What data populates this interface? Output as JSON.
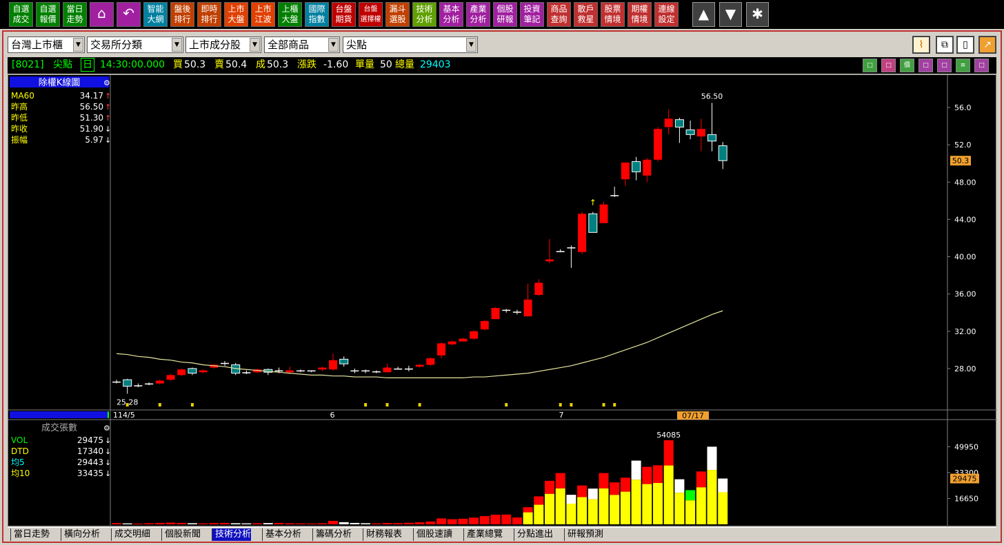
{
  "toolbar": {
    "buttons": [
      {
        "label": "自選\n成交",
        "color": "#008000"
      },
      {
        "label": "自選\n報價",
        "color": "#008000"
      },
      {
        "label": "當日\n走勢",
        "color": "#008000"
      },
      {
        "label": "",
        "icon": "home-icon",
        "color": "#a020a0"
      },
      {
        "label": "",
        "icon": "back-icon",
        "color": "#a020a0"
      },
      {
        "label": "智能\n大網",
        "color": "#0080a0"
      },
      {
        "label": "盤後\n排行",
        "color": "#c04000"
      },
      {
        "label": "即時\n排行",
        "color": "#c04000"
      },
      {
        "label": "上市\n大盤",
        "color": "#e04000"
      },
      {
        "label": "上市\n江波",
        "color": "#e04000"
      },
      {
        "label": "上櫃\n大盤",
        "color": "#008000"
      },
      {
        "label": "國際\n指數",
        "color": "#0080a0"
      },
      {
        "label": "台盤\n期貨",
        "color": "#c00000"
      },
      {
        "label": "台盤\n選擇權",
        "color": "#c00000"
      },
      {
        "label": "漏斗\n選股",
        "color": "#c04000"
      },
      {
        "label": "技術\n分析",
        "color": "#60a000"
      },
      {
        "label": "基本\n分析",
        "color": "#a020a0"
      },
      {
        "label": "產業\n分析",
        "color": "#a020a0"
      },
      {
        "label": "個股\n研報",
        "color": "#a020a0"
      },
      {
        "label": "投資\n筆記",
        "color": "#a020a0"
      },
      {
        "label": "商品\n查詢",
        "color": "#c03030"
      },
      {
        "label": "散戶\n救星",
        "color": "#c03030"
      },
      {
        "label": "股票\n情境",
        "color": "#c03030"
      },
      {
        "label": "期權\n情境",
        "color": "#c03030"
      },
      {
        "label": "連線\n設定",
        "color": "#c03030"
      }
    ],
    "up_glyph": "▲",
    "down_glyph": "▼",
    "star_glyph": "✱"
  },
  "filters": {
    "market": "台灣上市櫃",
    "category": "交易所分類",
    "sector": "上市成分股",
    "product": "全部商品",
    "stock": "尖點"
  },
  "quote": {
    "code": "[8021]",
    "name": "尖點",
    "period": "日",
    "time": "14:30:00.000",
    "bid_label": "買",
    "bid": "50.3",
    "ask_label": "賣",
    "ask": "50.4",
    "last_label": "成",
    "last": "50.3",
    "change_label": "漲跌",
    "change": "-1.60",
    "vol_label": "單量",
    "vol": "50",
    "total_label": "總量",
    "total": "29403",
    "icons": [
      "□",
      "□",
      "價",
      "□",
      "□",
      "≡",
      "□"
    ]
  },
  "kchart": {
    "title": "除權K線圖",
    "stats": [
      {
        "label": "MA60",
        "value": "34.17",
        "arrow": "↑",
        "label_color": "#ffff00"
      },
      {
        "label": "昨高",
        "value": "56.50",
        "arrow": "↑",
        "label_color": "#ffff00"
      },
      {
        "label": "昨低",
        "value": "51.30",
        "arrow": "↑",
        "label_color": "#ffff00"
      },
      {
        "label": "昨收",
        "value": "51.90",
        "arrow": "↓",
        "label_color": "#ffff00"
      },
      {
        "label": "振幅",
        "value": "5.97",
        "arrow": "↓",
        "label_color": "#ffff00"
      }
    ],
    "y_ticks": [
      "56.0",
      "52.0",
      "48.00",
      "44.00",
      "40.00",
      "36.00",
      "32.00",
      "28.00"
    ],
    "current_price": "50.3",
    "high_label": "56.50",
    "low_label": "25.28",
    "x_labels": [
      "114/5",
      "6",
      "7"
    ],
    "date_badge": "07/17"
  },
  "volchart": {
    "title": "成交張數",
    "stats": [
      {
        "label": "VOL",
        "value": "29475",
        "arrow": "↓",
        "label_color": "#00ff00"
      },
      {
        "label": "DTD",
        "value": "17340",
        "arrow": "↓",
        "label_color": "#ffff00"
      },
      {
        "label": "均5",
        "value": "29443",
        "arrow": "↓",
        "label_color": "#00ffff"
      },
      {
        "label": "均10",
        "value": "33435",
        "arrow": "↓",
        "label_color": "#ffff00"
      }
    ],
    "y_ticks": [
      "49950",
      "33300",
      "16650"
    ],
    "current": "29475",
    "peak_label": "54085"
  },
  "chart_data": {
    "type": "candlestick",
    "y_range": [
      24,
      58
    ],
    "candles": [
      [
        26.6,
        26.8,
        26.4,
        26.6
      ],
      [
        26.8,
        26.9,
        25.3,
        26.1
      ],
      [
        26.2,
        26.4,
        26.0,
        26.2
      ],
      [
        26.3,
        26.5,
        26.2,
        26.4
      ],
      [
        26.4,
        26.8,
        26.3,
        26.7
      ],
      [
        26.8,
        27.4,
        26.7,
        27.3
      ],
      [
        27.3,
        28.0,
        27.2,
        27.9
      ],
      [
        28.0,
        28.1,
        27.3,
        27.5
      ],
      [
        27.6,
        27.9,
        27.5,
        27.8
      ],
      [
        28.1,
        28.5,
        28.0,
        28.4
      ],
      [
        28.5,
        28.8,
        28.3,
        28.6
      ],
      [
        28.4,
        28.6,
        27.3,
        27.5
      ],
      [
        27.6,
        27.8,
        27.4,
        27.5
      ],
      [
        27.6,
        28.0,
        27.5,
        27.9
      ],
      [
        27.9,
        28.0,
        27.3,
        27.6
      ],
      [
        27.7,
        28.1,
        27.5,
        27.8
      ],
      [
        27.6,
        28.2,
        27.4,
        27.8
      ],
      [
        27.7,
        27.9,
        27.6,
        27.8
      ],
      [
        27.8,
        27.8,
        27.6,
        27.8
      ],
      [
        27.9,
        28.2,
        27.7,
        28.1
      ],
      [
        27.9,
        29.6,
        27.8,
        28.9
      ],
      [
        29.0,
        29.3,
        28.2,
        28.5
      ],
      [
        27.8,
        28.0,
        27.5,
        27.7
      ],
      [
        27.8,
        27.9,
        27.5,
        27.7
      ],
      [
        27.6,
        27.8,
        27.5,
        27.7
      ],
      [
        27.6,
        28.5,
        27.6,
        28.1
      ],
      [
        28.0,
        28.2,
        27.9,
        28.0
      ],
      [
        28.0,
        28.3,
        27.7,
        28.0
      ],
      [
        28.2,
        28.5,
        28.1,
        28.4
      ],
      [
        28.4,
        29.2,
        28.3,
        29.1
      ],
      [
        29.4,
        30.8,
        29.1,
        30.7
      ],
      [
        30.6,
        31.0,
        30.5,
        30.9
      ],
      [
        30.9,
        31.3,
        30.9,
        31.2
      ],
      [
        31.2,
        32.1,
        31.1,
        32.0
      ],
      [
        32.2,
        33.2,
        32.1,
        33.1
      ],
      [
        33.3,
        34.6,
        33.3,
        34.5
      ],
      [
        34.3,
        34.4,
        34.0,
        34.3
      ],
      [
        34.1,
        34.3,
        33.8,
        34.1
      ],
      [
        33.6,
        37.1,
        33.6,
        35.4
      ],
      [
        35.9,
        37.6,
        35.8,
        37.2
      ],
      [
        39.5,
        41.9,
        39.3,
        39.7
      ],
      [
        40.6,
        40.8,
        40.5,
        40.6
      ],
      [
        41.0,
        41.2,
        38.8,
        40.9
      ],
      [
        40.5,
        44.8,
        40.3,
        44.6
      ],
      [
        44.6,
        44.8,
        42.7,
        42.6
      ],
      [
        43.6,
        45.9,
        43.6,
        45.6
      ],
      [
        46.5,
        47.5,
        46.4,
        46.6
      ],
      [
        48.3,
        50.0,
        47.6,
        50.1
      ],
      [
        50.2,
        50.7,
        48.2,
        49.1
      ],
      [
        48.7,
        50.6,
        48.0,
        50.4
      ],
      [
        50.4,
        53.9,
        50.2,
        53.7
      ],
      [
        53.9,
        55.8,
        53.1,
        54.8
      ],
      [
        54.7,
        54.9,
        52.2,
        53.9
      ],
      [
        53.6,
        54.6,
        52.6,
        53.1
      ],
      [
        52.9,
        54.8,
        51.3,
        53.7
      ],
      [
        53.1,
        56.5,
        51.3,
        52.4
      ],
      [
        51.9,
        52.3,
        49.4,
        50.3
      ]
    ],
    "ma60": [
      29.6,
      29.5,
      29.3,
      29.2,
      29.0,
      28.9,
      28.7,
      28.6,
      28.4,
      28.3,
      28.2,
      28.0,
      27.9,
      27.8,
      27.7,
      27.6,
      27.5,
      27.4,
      27.3,
      27.3,
      27.2,
      27.2,
      27.1,
      27.1,
      27.1,
      27.0,
      27.0,
      27.0,
      27.0,
      27.0,
      27.0,
      27.0,
      27.0,
      27.1,
      27.1,
      27.2,
      27.3,
      27.4,
      27.5,
      27.7,
      27.9,
      28.1,
      28.3,
      28.6,
      28.9,
      29.2,
      29.6,
      30.0,
      30.4,
      30.8,
      31.3,
      31.8,
      32.3,
      32.8,
      33.3,
      33.8,
      34.2
    ],
    "volume": [
      800,
      600,
      500,
      700,
      900,
      1100,
      900,
      700,
      600,
      800,
      900,
      700,
      600,
      700,
      800,
      900,
      700,
      600,
      500,
      700,
      2200,
      1400,
      900,
      700,
      600,
      900,
      800,
      1000,
      1300,
      1800,
      3800,
      3300,
      3600,
      4300,
      5300,
      6200,
      6300,
      4400,
      11000,
      18000,
      28000,
      33000,
      19000,
      25000,
      23000,
      33000,
      27000,
      30000,
      41000,
      37000,
      38000,
      54085,
      29000,
      22000,
      34000,
      49950,
      29475
    ],
    "vol_max": 54085
  }
}
